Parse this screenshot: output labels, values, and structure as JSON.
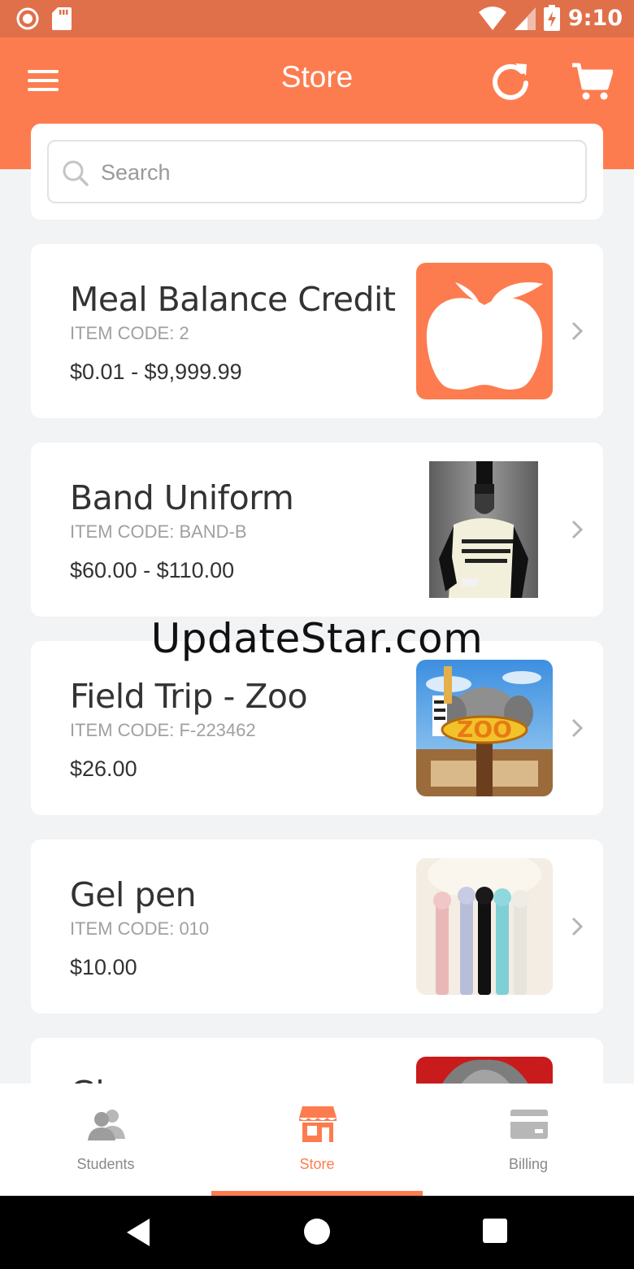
{
  "status_bar": {
    "time": "9:10"
  },
  "header": {
    "title": "Store"
  },
  "search": {
    "placeholder": "Search",
    "value": ""
  },
  "items": [
    {
      "name": "Meal Balance Credit",
      "code": "ITEM CODE: 2",
      "price": "$0.01 - $9,999.99",
      "image": "apple-logo"
    },
    {
      "name": "Band Uniform",
      "code": "ITEM CODE: BAND-B",
      "price": "$60.00 - $110.00",
      "image": "band-uniform-photo"
    },
    {
      "name": "Field Trip - Zoo",
      "code": "ITEM CODE: F-223462",
      "price": "$26.00",
      "image": "zoo-photo"
    },
    {
      "name": "Gel pen",
      "code": "ITEM CODE: 010",
      "price": "$10.00",
      "image": "gel-pens-photo"
    },
    {
      "name": "Gl",
      "image": "partial-photo"
    }
  ],
  "bottom_nav": {
    "tabs": [
      {
        "label": "Students",
        "icon": "students-icon"
      },
      {
        "label": "Store",
        "icon": "store-icon",
        "active": true
      },
      {
        "label": "Billing",
        "icon": "billing-icon"
      }
    ]
  },
  "watermark": "UpdateStar.com",
  "colors": {
    "accent": "#fd7c4f",
    "status_bar": "#e0704a",
    "background": "#f2f3f5"
  }
}
